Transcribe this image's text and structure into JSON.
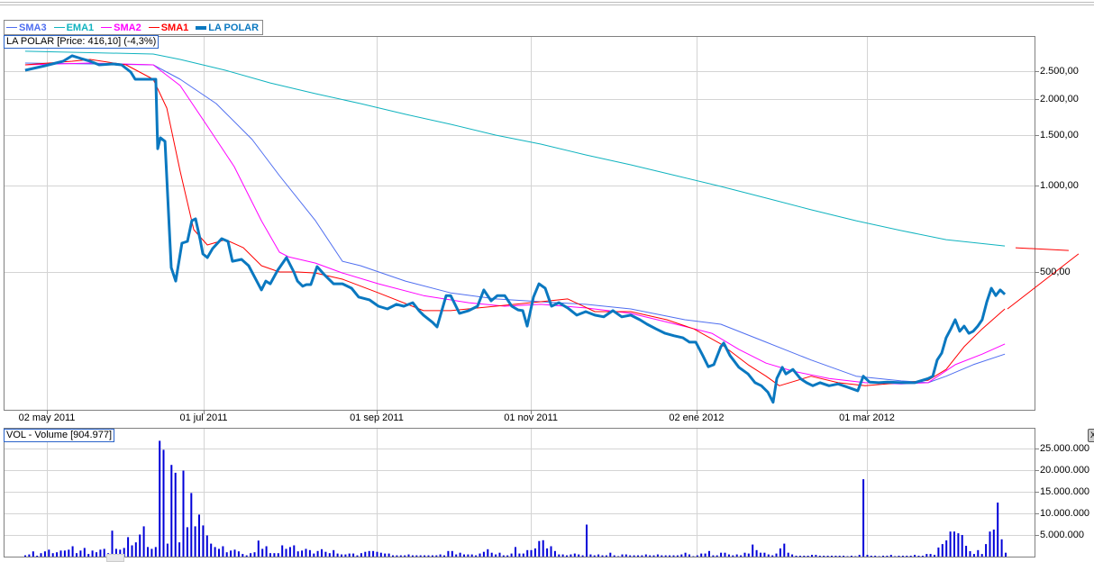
{
  "legend": [
    {
      "name": "SMA3",
      "color": "#4f6ef0"
    },
    {
      "name": "EMA1",
      "color": "#10b3bf"
    },
    {
      "name": "SMA2",
      "color": "#ff00ff"
    },
    {
      "name": "SMA1",
      "color": "#ff0000"
    },
    {
      "name": "LA POLAR",
      "color": "#0a78c0"
    }
  ],
  "price_panel_label": "LA POLAR [Price: 416,10] (-4,3%)",
  "volume_panel_label": "VOL - Volume [904.977]",
  "close_icon_label": "X",
  "chart_data": [
    {
      "type": "line",
      "title": "LA POLAR",
      "yscale": "log",
      "ylim": [
        170,
        3000
      ],
      "xlim_days": [
        -16.5,
        378
      ],
      "x_unit": "days since 02 may 2011",
      "grid": true,
      "legend_position": "top-left",
      "x_ticks": [
        {
          "label": "02 may 2011",
          "day": 0
        },
        {
          "label": "01 jul 2011",
          "day": 60
        },
        {
          "label": "01 sep 2011",
          "day": 126.2
        },
        {
          "label": "01 nov 2011",
          "day": 185.2
        },
        {
          "label": "02 ene 2012",
          "day": 248.6
        },
        {
          "label": "01 mar 2012",
          "day": 313.8
        }
      ],
      "y_ticks": [
        {
          "label": "2.500,00",
          "value": 2500
        },
        {
          "label": "2.000,00",
          "value": 2000
        },
        {
          "label": "1.500,00",
          "value": 1500
        },
        {
          "label": "1.000,00",
          "value": 1000
        },
        {
          "label": "500,00",
          "value": 500
        }
      ],
      "series": [
        {
          "name": "LA POLAR",
          "color": "#0a78c0",
          "width": 3,
          "days": [
            -8.3,
            -0.7,
            6.2,
            9.7,
            13.1,
            16.6,
            20,
            25.2,
            28.6,
            32.1,
            33.8,
            40.7,
            41.7,
            42.4,
            43.4,
            45.2,
            47.6,
            49.3,
            51.7,
            53.8,
            55.5,
            56.9,
            58.6,
            59.7,
            61.4,
            63.4,
            66.9,
            69.3,
            71,
            74.5,
            77.2,
            82.1,
            83.8,
            85.5,
            88.3,
            91.7,
            94.5,
            95.9,
            97.9,
            99.3,
            101,
            103.4,
            106.2,
            109.7,
            113.1,
            116.6,
            119.3,
            123.4,
            126.9,
            130.3,
            133.8,
            136.6,
            140,
            142.4,
            144.1,
            147.6,
            149.3,
            152.8,
            154.5,
            157.9,
            161.4,
            164.8,
            167.2,
            170,
            172.4,
            175.2,
            177.9,
            180.3,
            182.1,
            183.8,
            186.2,
            188.3,
            190.7,
            193.1,
            195.9,
            199.3,
            202.8,
            206.2,
            209.7,
            213.1,
            216.6,
            220,
            223.4,
            226.9,
            229.7,
            233.1,
            236.6,
            240,
            243.4,
            245.9,
            248.3,
            251,
            253.1,
            255.2,
            257.9,
            259,
            261.4,
            264.8,
            268.3,
            271,
            273.4,
            275.9,
            277.9,
            279.3,
            281.4,
            282.8,
            285.5,
            288.3,
            290.7,
            293.1,
            295.9,
            299.3,
            302.8,
            306.2,
            310.3,
            312.4,
            314.8,
            318.3,
            321.7,
            326.9,
            332.1,
            337.2,
            339,
            340.7,
            342.4,
            344.1,
            345.9,
            347.6,
            349.3,
            351,
            352.8,
            354.5,
            356.2,
            357.9,
            359.7,
            361.4,
            363.1,
            364.8,
            366.6
          ],
          "values": [
            2516,
            2609,
            2705,
            2826,
            2764,
            2705,
            2628,
            2647,
            2628,
            2481,
            2342,
            2342,
            2342,
            1343,
            1465,
            1423,
            518,
            465,
            630,
            639,
            754,
            766,
            653,
            578,
            561,
            603,
            653,
            639,
            545,
            553,
            526,
            433,
            465,
            455,
            507,
            561,
            500,
            465,
            446,
            452,
            452,
            522,
            489,
            455,
            455,
            439,
            409,
            400,
            380,
            372,
            386,
            380,
            391,
            367,
            354,
            334,
            322,
            414,
            414,
            359,
            367,
            380,
            433,
            397,
            414,
            414,
            380,
            369,
            367,
            324,
            409,
            455,
            439,
            380,
            391,
            375,
            354,
            364,
            354,
            349,
            367,
            349,
            354,
            341,
            329,
            317,
            306,
            300,
            295,
            285,
            285,
            256,
            234,
            238,
            275,
            283,
            256,
            233,
            221,
            206,
            201,
            191,
            176,
            213,
            233,
            221,
            229,
            213,
            206,
            201,
            206,
            201,
            204,
            199,
            193,
            217,
            207,
            206,
            207,
            206,
            206,
            213,
            217,
            247,
            261,
            295,
            317,
            341,
            311,
            324,
            306,
            311,
            324,
            341,
            394,
            439,
            414,
            433,
            418
          ]
        },
        {
          "name": "SMA1",
          "color": "#ff0000",
          "width": 1,
          "days": [
            -8.3,
            9.7,
            16.6,
            30.3,
            40.7,
            45.9,
            51,
            56.2,
            61.4,
            68.3,
            75.2,
            82.1,
            89,
            95.9,
            102.8,
            113.1,
            126.9,
            144.1,
            154.5,
            171.7,
            189,
            199.3,
            209.7,
            223.4,
            237.2,
            247.6,
            257.9,
            268.3,
            275.2,
            280.3,
            292.4,
            302.8,
            313.1,
            326.9,
            337.2,
            344.1,
            351,
            357.9,
            366.6
          ],
          "values": [
            2628,
            2705,
            2745,
            2628,
            2342,
            1859,
            1122,
            702,
            621,
            648,
            607,
            526,
            500,
            500,
            496,
            472,
            423,
            367,
            367,
            380,
            394,
            403,
            364,
            364,
            341,
            317,
            281,
            238,
            217,
            201,
            217,
            206,
            201,
            206,
            210,
            229,
            275,
            317,
            372
          ]
        },
        {
          "name": "SMA1 projection",
          "color": "#ff0000",
          "width": 1,
          "days": [
            367.6,
            394.8
          ],
          "values": [
            372,
            578
          ]
        },
        {
          "name": "SMA1 level",
          "color": "#ff0000",
          "width": 1,
          "days": [
            370.7,
            391
          ],
          "values": [
            607,
            594
          ]
        },
        {
          "name": "SMA2",
          "color": "#ff00ff",
          "width": 1,
          "days": [
            -8.3,
            16.6,
            40.7,
            51,
            61.4,
            71.7,
            82.1,
            89,
            92.4,
            102.8,
            113.1,
            126.9,
            144.1,
            161.4,
            175.2,
            189,
            206.2,
            223.4,
            240.7,
            254.5,
            264.8,
            275.2,
            285.5,
            299.3,
            313.1,
            326.9,
            337.2,
            347.6,
            357.9,
            366.6
          ],
          "values": [
            2628,
            2667,
            2628,
            2227,
            1609,
            1163,
            754,
            586,
            565,
            537,
            496,
            455,
            414,
            391,
            380,
            386,
            375,
            359,
            329,
            306,
            269,
            241,
            226,
            213,
            206,
            204,
            206,
            238,
            259,
            281
          ]
        },
        {
          "name": "SMA3",
          "color": "#4f6ef0",
          "width": 1,
          "days": [
            -8.3,
            16.6,
            40.7,
            51,
            64.8,
            78.6,
            89,
            102.8,
            113.1,
            120,
            137.2,
            154.5,
            171.7,
            189,
            206.2,
            223.4,
            244.1,
            257.9,
            275.2,
            292.4,
            309.7,
            326.9,
            337.2,
            344.1,
            354.5,
            366.6
          ],
          "values": [
            2667,
            2647,
            2628,
            2342,
            1927,
            1444,
            1082,
            754,
            545,
            526,
            465,
            423,
            403,
            394,
            386,
            372,
            341,
            329,
            285,
            247,
            217,
            209,
            206,
            217,
            238,
            259
          ]
        },
        {
          "name": "EMA1",
          "color": "#10b3bf",
          "width": 1,
          "days": [
            -8.3,
            40.7,
            51,
            68.3,
            85.5,
            102.8,
            120,
            137.2,
            154.5,
            171.7,
            189,
            206.2,
            223.4,
            240.7,
            257.9,
            275.2,
            292.4,
            309.7,
            326.9,
            344.1,
            366.6
          ],
          "values": [
            2930,
            2866,
            2745,
            2516,
            2274,
            2086,
            1927,
            1768,
            1632,
            1497,
            1393,
            1277,
            1180,
            1082,
            992,
            904,
            823,
            754,
            697,
            648,
            616
          ]
        }
      ]
    },
    {
      "type": "bar",
      "title": "VOL - Volume",
      "unit": "millions of shares",
      "ylim": [
        0,
        27
      ],
      "grid": true,
      "y_ticks": [
        {
          "label": "25.000.000",
          "value": 25
        },
        {
          "label": "20.000.000",
          "value": 20
        },
        {
          "label": "15.000.000",
          "value": 15
        },
        {
          "label": "10.000.000",
          "value": 10
        },
        {
          "label": "5.000.000",
          "value": 5
        }
      ],
      "color": "#0000d8",
      "values": [
        0.3,
        0.5,
        1.2,
        0.2,
        0.8,
        1.2,
        1.6,
        0.8,
        1,
        1.4,
        1.4,
        1.6,
        2.4,
        0.8,
        1.4,
        2,
        0.6,
        1.4,
        1,
        1.6,
        1.8,
        0.8,
        6,
        1.8,
        1.6,
        2,
        4.5,
        2.6,
        3.3,
        5.1,
        7,
        2.2,
        1.8,
        2.2,
        26.8,
        24.7,
        3,
        21.2,
        19.4,
        3.3,
        19.9,
        6.8,
        14.7,
        7,
        9.7,
        7.2,
        4.9,
        3,
        2.2,
        1.8,
        2.4,
        1,
        1.4,
        1.6,
        1.2,
        0.6,
        0.3,
        0.8,
        1,
        3.7,
        1.8,
        2.4,
        0.8,
        0.8,
        0.8,
        2.6,
        1.8,
        2.2,
        2.6,
        1.2,
        1.4,
        1.8,
        1.5,
        0.7,
        1.3,
        1.7,
        1.1,
        0.8,
        1.5,
        0.7,
        0.5,
        0.5,
        0.7,
        0.7,
        0.3,
        0.8,
        1.1,
        1.3,
        1.3,
        1.1,
        0.9,
        0.7,
        0.7,
        0.3,
        0.3,
        0.3,
        0.3,
        0.5,
        0.3,
        0.3,
        0.3,
        0.3,
        0.3,
        0.3,
        0.3,
        0.5,
        0.3,
        1.3,
        1.3,
        0.5,
        0.9,
        0.5,
        0.5,
        0.5,
        0.3,
        0.7,
        1.1,
        1.7,
        0.9,
        0.5,
        0.9,
        0.3,
        0.3,
        0.7,
        2.2,
        0.7,
        0.7,
        1.5,
        1.5,
        1.9,
        3.6,
        3.8,
        1.9,
        2.4,
        1.3,
        0.5,
        0.5,
        0.3,
        0.5,
        0.7,
        0.5,
        0.3,
        7.4,
        0.5,
        0.3,
        0.5,
        0.3,
        0.3,
        0.9,
        0.3,
        0.1,
        0.5,
        0.5,
        0.3,
        0.3,
        0.3,
        0.3,
        0.5,
        0.3,
        0.3,
        0.5,
        0.3,
        0.3,
        0.3,
        0.3,
        0.3,
        0.5,
        0.9,
        0.5,
        0.1,
        0.3,
        0.7,
        0.7,
        1.3,
        0.3,
        0.3,
        0.9,
        0.9,
        0.5,
        0.3,
        0.5,
        0.3,
        0.9,
        0.7,
        2.8,
        1.5,
        0.9,
        0.9,
        0.5,
        0.3,
        0.7,
        1.9,
        3,
        0.9,
        0.5,
        0.2,
        0.2,
        0.2,
        0.2,
        0.4,
        0.4,
        0.2,
        0.2,
        0.2,
        0.2,
        0.2,
        0.2,
        0.2,
        0.1,
        0.2,
        0.1,
        0.4,
        17.9,
        0.4,
        0.2,
        0.2,
        0.1,
        0.2,
        0.2,
        0.4,
        0.1,
        0.2,
        0.2,
        0.2,
        0.2,
        0.4,
        0.2,
        0.2,
        0.6,
        0.6,
        0.4,
        2.1,
        2.9,
        3.75,
        5.8,
        5.8,
        5.4,
        5,
        2.5,
        1.25,
        0.6,
        1.5,
        0.6,
        2.9,
        5.8,
        6.25,
        12.5,
        4,
        0.9
      ]
    }
  ]
}
